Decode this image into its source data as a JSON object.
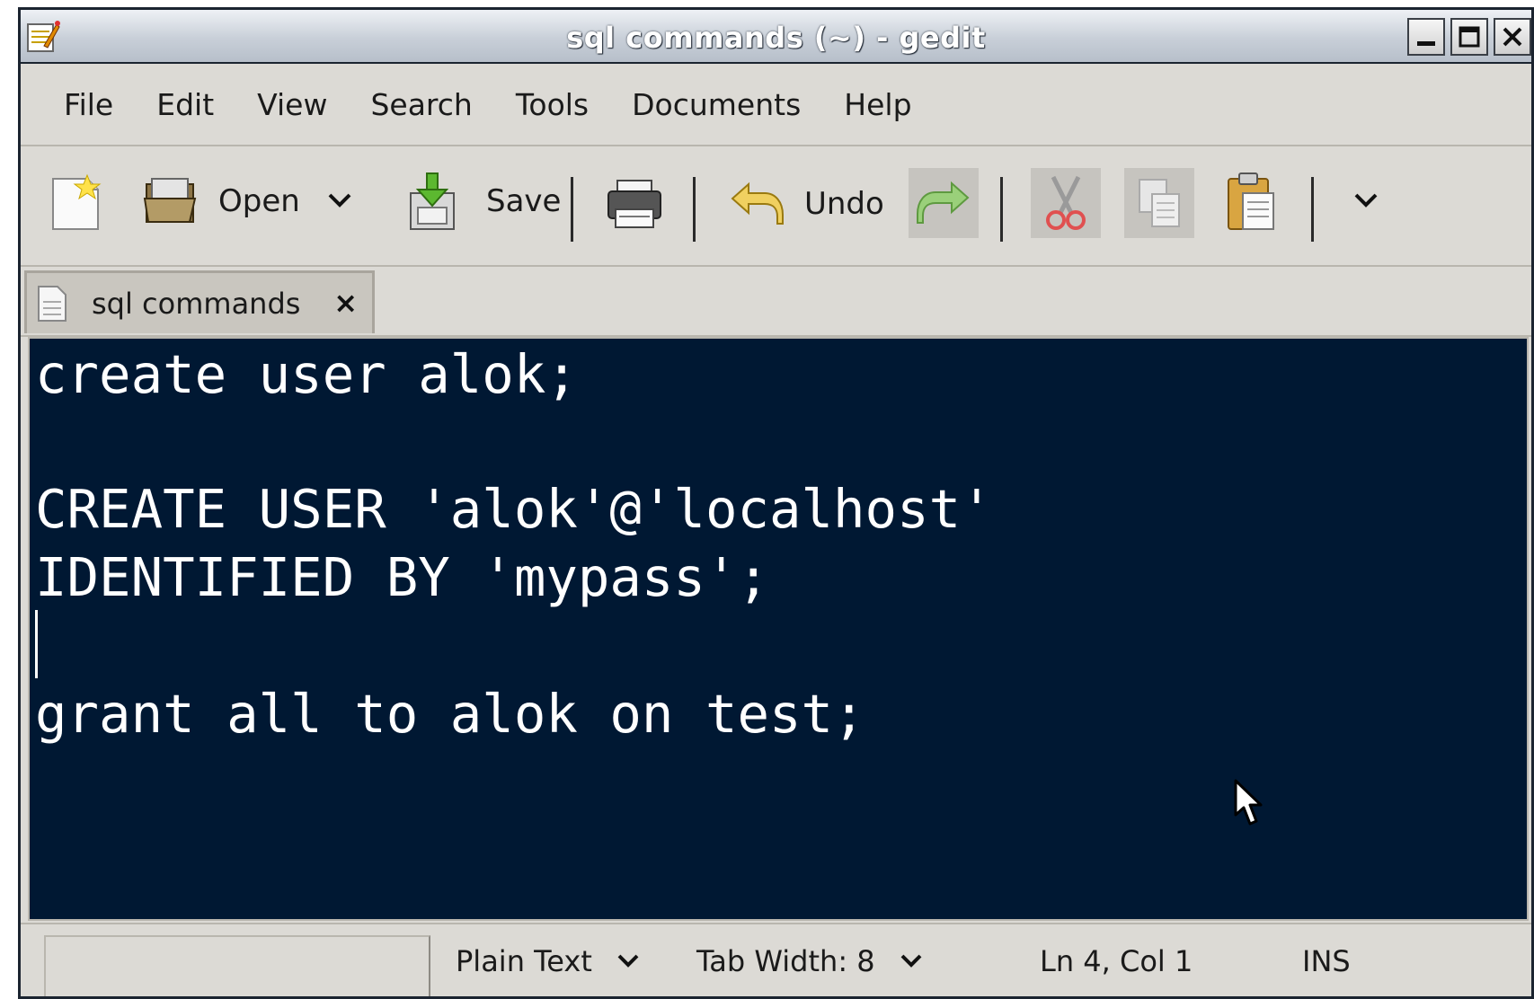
{
  "window": {
    "title": "sql commands (~) - gedit"
  },
  "menu": [
    "File",
    "Edit",
    "View",
    "Search",
    "Tools",
    "Documents",
    "Help"
  ],
  "toolbar": {
    "open_label": "Open",
    "save_label": "Save",
    "undo_label": "Undo"
  },
  "tab": {
    "label": "sql commands",
    "close": "×"
  },
  "editor": {
    "lines": [
      "create user alok;",
      "",
      "CREATE USER 'alok'@'localhost'",
      "IDENTIFIED BY 'mypass';",
      "",
      "grant all to alok on test;"
    ],
    "background": "#001833",
    "foreground": "#ffffff"
  },
  "status": {
    "language": "Plain Text",
    "tab_width": "Tab Width: 8",
    "position": "Ln 4, Col 1",
    "mode": "INS"
  },
  "icons": [
    "app-notepad-icon",
    "minimize-icon",
    "maximize-icon",
    "close-icon",
    "new-document-icon",
    "open-folder-icon",
    "chevron-down-icon",
    "save-icon",
    "print-icon",
    "undo-icon",
    "redo-icon",
    "cut-icon",
    "copy-icon",
    "paste-icon",
    "text-document-icon"
  ]
}
